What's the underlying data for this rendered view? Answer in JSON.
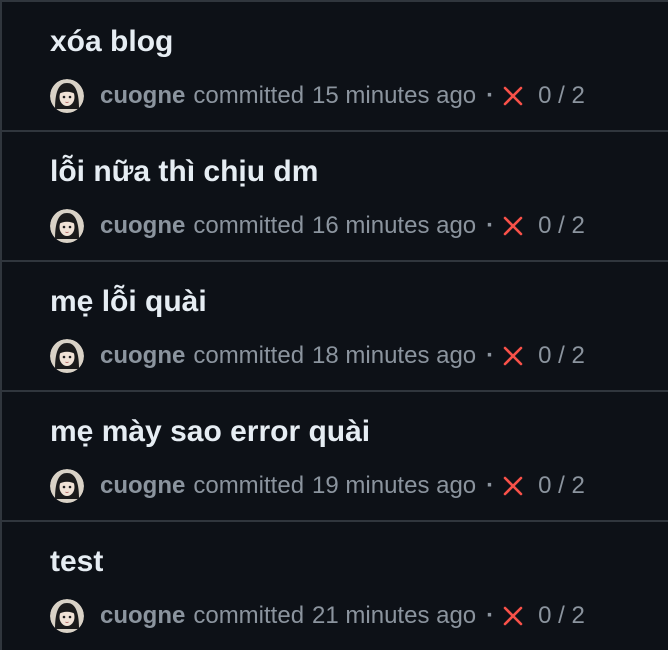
{
  "commits": [
    {
      "title": "xóa blog",
      "author": "cuogne",
      "verb": "committed",
      "time": "15 minutes ago",
      "separator": "·",
      "status": "failure",
      "checks": "0 / 2"
    },
    {
      "title": "lỗi nữa thì chịu dm",
      "author": "cuogne",
      "verb": "committed",
      "time": "16 minutes ago",
      "separator": "·",
      "status": "failure",
      "checks": "0 / 2"
    },
    {
      "title": "mẹ lỗi quài",
      "author": "cuogne",
      "verb": "committed",
      "time": "18 minutes ago",
      "separator": "·",
      "status": "failure",
      "checks": "0 / 2"
    },
    {
      "title": "mẹ mày sao error quài",
      "author": "cuogne",
      "verb": "committed",
      "time": "19 minutes ago",
      "separator": "·",
      "status": "failure",
      "checks": "0 / 2"
    },
    {
      "title": "test",
      "author": "cuogne",
      "verb": "committed",
      "time": "21 minutes ago",
      "separator": "·",
      "status": "failure",
      "checks": "0 / 2"
    }
  ],
  "icons": {
    "status": "x-icon",
    "avatar": "avatar"
  },
  "colors": {
    "background": "#0d1117",
    "title": "#e6edf3",
    "meta": "#8b949e",
    "failure": "#f85149",
    "border": "#30363d"
  }
}
